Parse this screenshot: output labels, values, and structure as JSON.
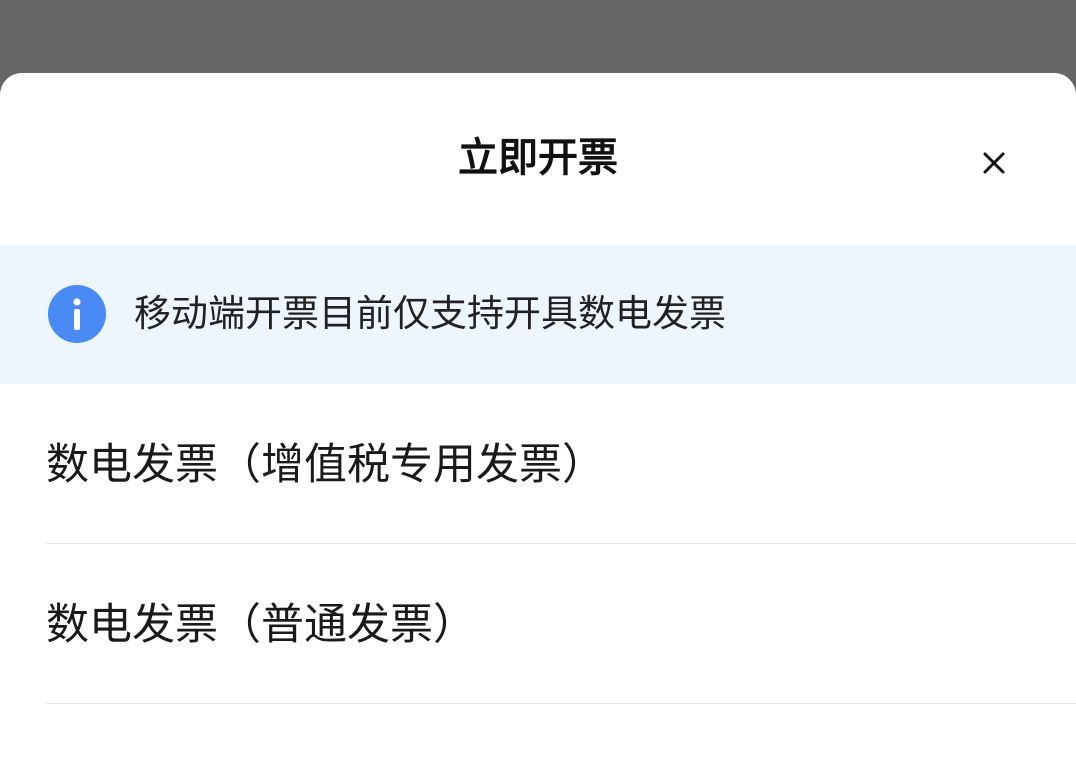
{
  "dialog": {
    "title": "立即开票",
    "close_icon": "close-icon"
  },
  "notice": {
    "icon": "info-icon",
    "icon_color": "#4a8af4",
    "text": "移动端开票目前仅支持开具数电发票",
    "background": "#eef6fd"
  },
  "options": [
    {
      "label": "数电发票（增值税专用发票）"
    },
    {
      "label": "数电发票（普通发票）"
    }
  ],
  "colors": {
    "backdrop": "#666666",
    "sheet": "#ffffff",
    "divider": "#e5e5e5"
  }
}
